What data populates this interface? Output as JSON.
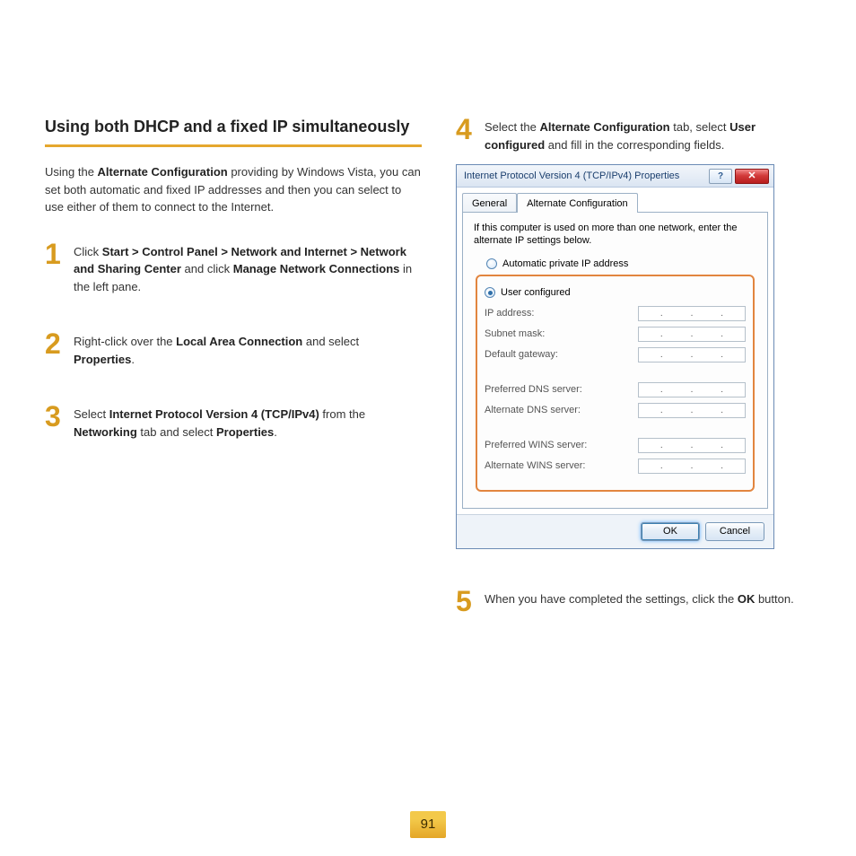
{
  "page_number": "91",
  "section_title": "Using both DHCP and a fixed IP simultaneously",
  "intro": {
    "t1": "Using the ",
    "b1": "Alternate Configuration",
    "t2": " providing by Windows Vista, you can set both automatic and fixed IP addresses and then you can select to use either of them to connect to the Internet."
  },
  "steps": {
    "s1": {
      "num": "1",
      "t1": "Click ",
      "b1": "Start > Control Panel > Network and Internet > Network and Sharing Center",
      "t2": " and click ",
      "b2": "Manage Network Connections",
      "t3": " in the left pane."
    },
    "s2": {
      "num": "2",
      "t1": "Right-click over the ",
      "b1": "Local Area Connection",
      "t2": " and select ",
      "b2": "Properties",
      "t3": "."
    },
    "s3": {
      "num": "3",
      "t1": "Select ",
      "b1": "Internet Protocol Version 4 (TCP/IPv4)",
      "t2": " from the ",
      "b2": "Networking",
      "t3": " tab and select ",
      "b3": "Properties",
      "t4": "."
    },
    "s4": {
      "num": "4",
      "t1": "Select the ",
      "b1": "Alternate Configuration",
      "t2": " tab, select ",
      "b2": "User configured",
      "t3": " and fill in the corresponding fields."
    },
    "s5": {
      "num": "5",
      "t1": "When you have completed the settings, click the ",
      "b1": "OK",
      "t2": " button."
    }
  },
  "dialog": {
    "title": "Internet Protocol Version 4 (TCP/IPv4) Properties",
    "help_glyph": "?",
    "close_glyph": "✕",
    "tabs": {
      "general": "General",
      "alt": "Alternate Configuration"
    },
    "note": "If this computer is used on more than one network, enter the alternate IP settings below.",
    "radio_auto": "Automatic private IP address",
    "radio_user": "User configured",
    "labels": {
      "ip": "IP address:",
      "subnet": "Subnet mask:",
      "gateway": "Default gateway:",
      "pdns": "Preferred DNS server:",
      "adns": "Alternate DNS server:",
      "pwins": "Preferred WINS server:",
      "awins": "Alternate WINS server:"
    },
    "ok": "OK",
    "cancel": "Cancel",
    "ip_dot": "."
  }
}
